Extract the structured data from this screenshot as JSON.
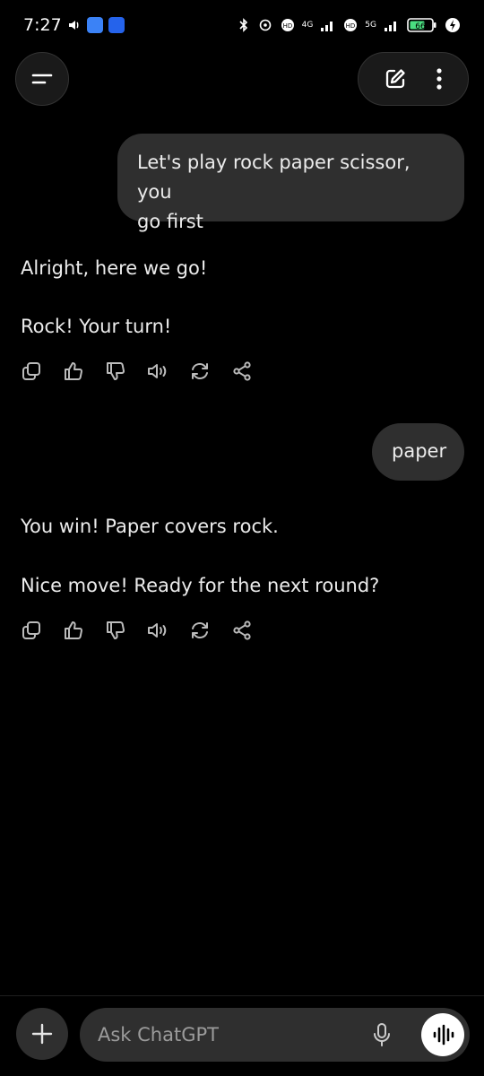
{
  "status_bar": {
    "time": "7:27",
    "network_1": "4G",
    "network_2": "5G",
    "battery": "66",
    "colors": {
      "app1": "#3b82f6",
      "app2": "#2563eb"
    }
  },
  "top_bar": {
    "menu_icon": "menu-icon",
    "new_chat_icon": "new-chat-icon",
    "more_icon": "more-vertical-icon"
  },
  "conversation": {
    "messages": [
      {
        "role": "user",
        "text_lines": [
          "Let's play rock paper scissor, you",
          "go first"
        ]
      },
      {
        "role": "assistant",
        "paragraphs": [
          "Alright, here we go!",
          "Rock! Your turn!"
        ]
      },
      {
        "role": "user",
        "text": "paper"
      },
      {
        "role": "assistant",
        "paragraphs": [
          "You win! Paper covers rock.",
          "Nice move! Ready for the next round?"
        ]
      }
    ],
    "action_icons": [
      "copy-icon",
      "thumbs-up-icon",
      "thumbs-down-icon",
      "read-aloud-icon",
      "regenerate-icon",
      "share-icon"
    ]
  },
  "composer": {
    "placeholder": "Ask ChatGPT",
    "value": ""
  }
}
